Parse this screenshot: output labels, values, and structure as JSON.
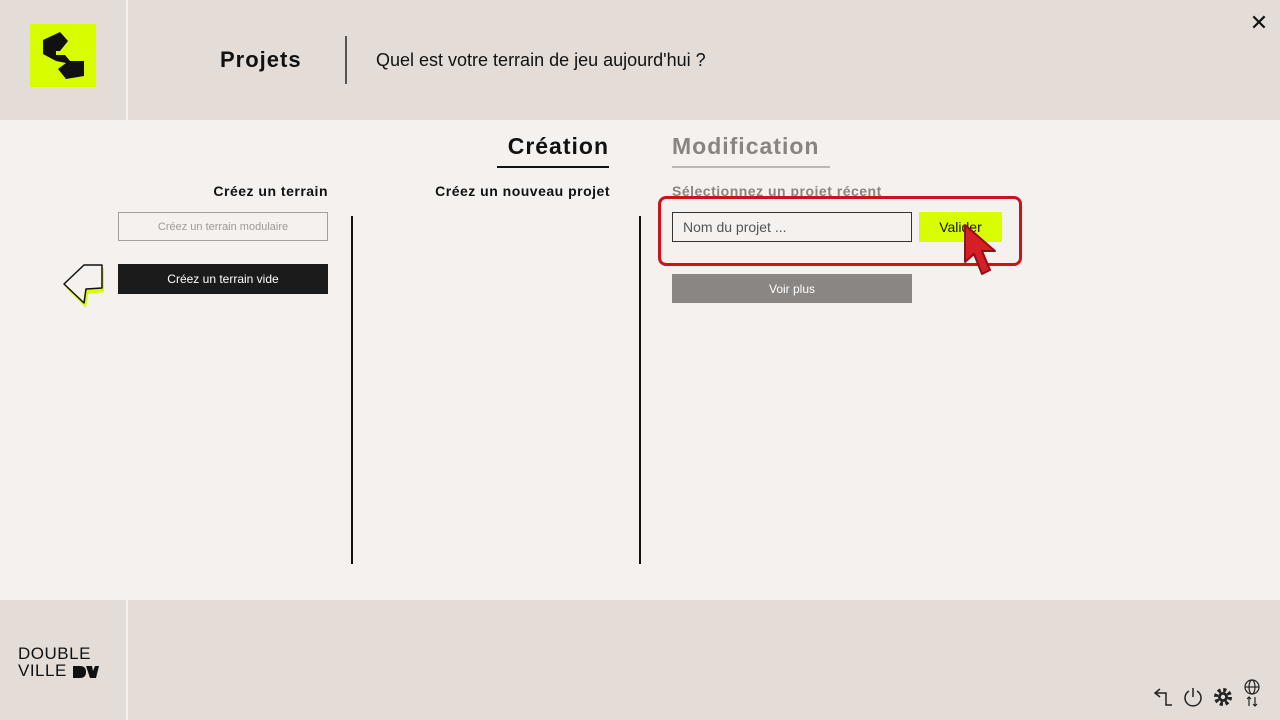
{
  "header": {
    "title": "Projets",
    "subtitle": "Quel est votre terrain de jeu aujourd'hui ?"
  },
  "tabs": [
    {
      "label": "Création",
      "active": true
    },
    {
      "label": "Modification",
      "active": false
    }
  ],
  "columns": {
    "terrain": {
      "heading": "Créez un terrain",
      "buttons": [
        "Créez un terrain modulaire",
        "Créez un terrain vide"
      ]
    },
    "projet": {
      "heading": "Créez un nouveau projet"
    },
    "recent": {
      "heading": "Sélectionnez un projet récent",
      "input_placeholder": "Nom du projet ...",
      "validate_label": "Valider",
      "more_label": "Voir plus"
    }
  },
  "brand": {
    "line1": "DOUBLE",
    "line2": "VILLE"
  },
  "footer": {
    "icons": [
      "back-icon",
      "power-icon",
      "settings-icon",
      "language-icon"
    ]
  },
  "colors": {
    "accent": "#d8fc00",
    "highlight": "#c9141b",
    "bar": "#e4ddd7",
    "background": "#f4f1ee"
  }
}
